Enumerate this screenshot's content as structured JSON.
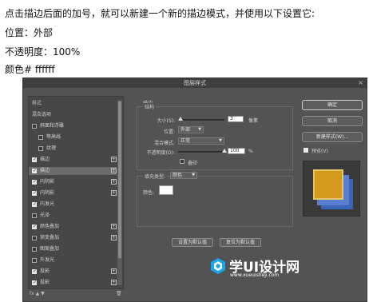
{
  "intro": {
    "line1": "点击描边后面的加号，就可以新建一个新的描边模式，并使用以下设置它:",
    "line2": "位置：外部",
    "line3": "不透明度：100%",
    "line4": "颜色# ffffff"
  },
  "dialog": {
    "title": "图层样式",
    "close": "×"
  },
  "style_list": [
    {
      "label": "样式",
      "checkbox": "none",
      "plus": false,
      "selected": false
    },
    {
      "label": "混合选项",
      "checkbox": "none",
      "plus": false,
      "selected": false
    },
    {
      "label": "斜面和浮雕",
      "checkbox": "off",
      "plus": false,
      "selected": false
    },
    {
      "label": "等高线",
      "checkbox": "off",
      "plus": false,
      "selected": false,
      "indent": true
    },
    {
      "label": "纹理",
      "checkbox": "off",
      "plus": false,
      "selected": false,
      "indent": true
    },
    {
      "label": "描边",
      "checkbox": "on",
      "plus": true,
      "selected": false
    },
    {
      "label": "描边",
      "checkbox": "on",
      "plus": true,
      "selected": true
    },
    {
      "label": "内阴影",
      "checkbox": "on",
      "plus": true,
      "selected": false
    },
    {
      "label": "内阴影",
      "checkbox": "on",
      "plus": true,
      "selected": false
    },
    {
      "label": "内发光",
      "checkbox": "on",
      "plus": false,
      "selected": false
    },
    {
      "label": "光泽",
      "checkbox": "off",
      "plus": false,
      "selected": false
    },
    {
      "label": "颜色叠加",
      "checkbox": "on",
      "plus": true,
      "selected": false
    },
    {
      "label": "渐变叠加",
      "checkbox": "off",
      "plus": true,
      "selected": false
    },
    {
      "label": "图案叠加",
      "checkbox": "off",
      "plus": false,
      "selected": false
    },
    {
      "label": "外发光",
      "checkbox": "off",
      "plus": false,
      "selected": false
    },
    {
      "label": "投影",
      "checkbox": "on",
      "plus": true,
      "selected": false
    },
    {
      "label": "投影",
      "checkbox": "on",
      "plus": true,
      "selected": false
    }
  ],
  "list_footer": {
    "icons": "fx  ▲  ▼",
    "trash": "🗑"
  },
  "stroke": {
    "section_title": "描边",
    "structure_title": "结构",
    "size_label": "大小(S):",
    "size_value": "3",
    "size_unit": "像素",
    "position_label": "位置:",
    "position_value": "外部",
    "blend_label": "混合模式:",
    "blend_value": "正常",
    "opacity_label": "不透明度(O):",
    "opacity_value": "100",
    "opacity_unit": "%",
    "overprint_label": "叠印",
    "fill_type_label": "填充类型:",
    "fill_type_value": "颜色",
    "color_label": "颜色:",
    "color_hex": "#ffffff",
    "default_btn": "设置为默认值",
    "reset_btn": "复位为默认值"
  },
  "right_panel": {
    "ok": "确定",
    "cancel": "取消",
    "new_style": "新建样式(W)...",
    "preview_label": "预览(V)",
    "preview_checked": true
  },
  "watermark": {
    "brand": "学UI设计网",
    "url": "www.xueuisheji.com"
  }
}
